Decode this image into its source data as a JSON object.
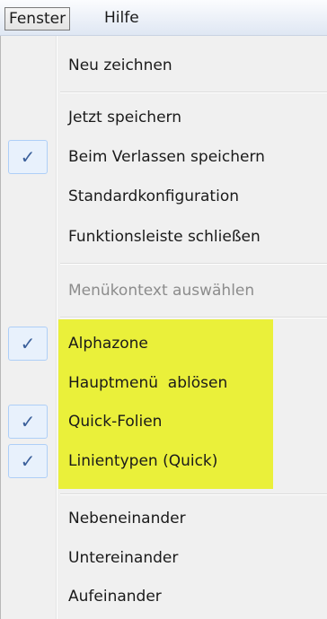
{
  "menubar": {
    "items": [
      {
        "label": "Fenster"
      },
      {
        "label": "Hilfe"
      }
    ]
  },
  "dropdown": {
    "items": [
      {
        "label": "Neu zeichnen",
        "checked": false,
        "enabled": true
      },
      {
        "label": "Jetzt speichern",
        "checked": false,
        "enabled": true
      },
      {
        "label": "Beim Verlassen speichern",
        "checked": true,
        "enabled": true
      },
      {
        "label": "Standardkonfiguration",
        "checked": false,
        "enabled": true
      },
      {
        "label": "Funktionsleiste schließen",
        "checked": false,
        "enabled": true
      },
      {
        "label": "Menükontext auswählen",
        "checked": false,
        "enabled": false
      },
      {
        "label": "Alphazone",
        "checked": true,
        "enabled": true
      },
      {
        "label": "Hauptmenü  ablösen",
        "checked": false,
        "enabled": true
      },
      {
        "label": "Quick-Folien",
        "checked": true,
        "enabled": true
      },
      {
        "label": "Linientypen (Quick)",
        "checked": true,
        "enabled": true
      },
      {
        "label": "Nebeneinander",
        "checked": false,
        "enabled": true
      },
      {
        "label": "Untereinander",
        "checked": false,
        "enabled": true
      },
      {
        "label": "Aufeinander",
        "checked": false,
        "enabled": true
      }
    ],
    "check_glyph": "✓",
    "highlight_color": "#eaf03a"
  }
}
